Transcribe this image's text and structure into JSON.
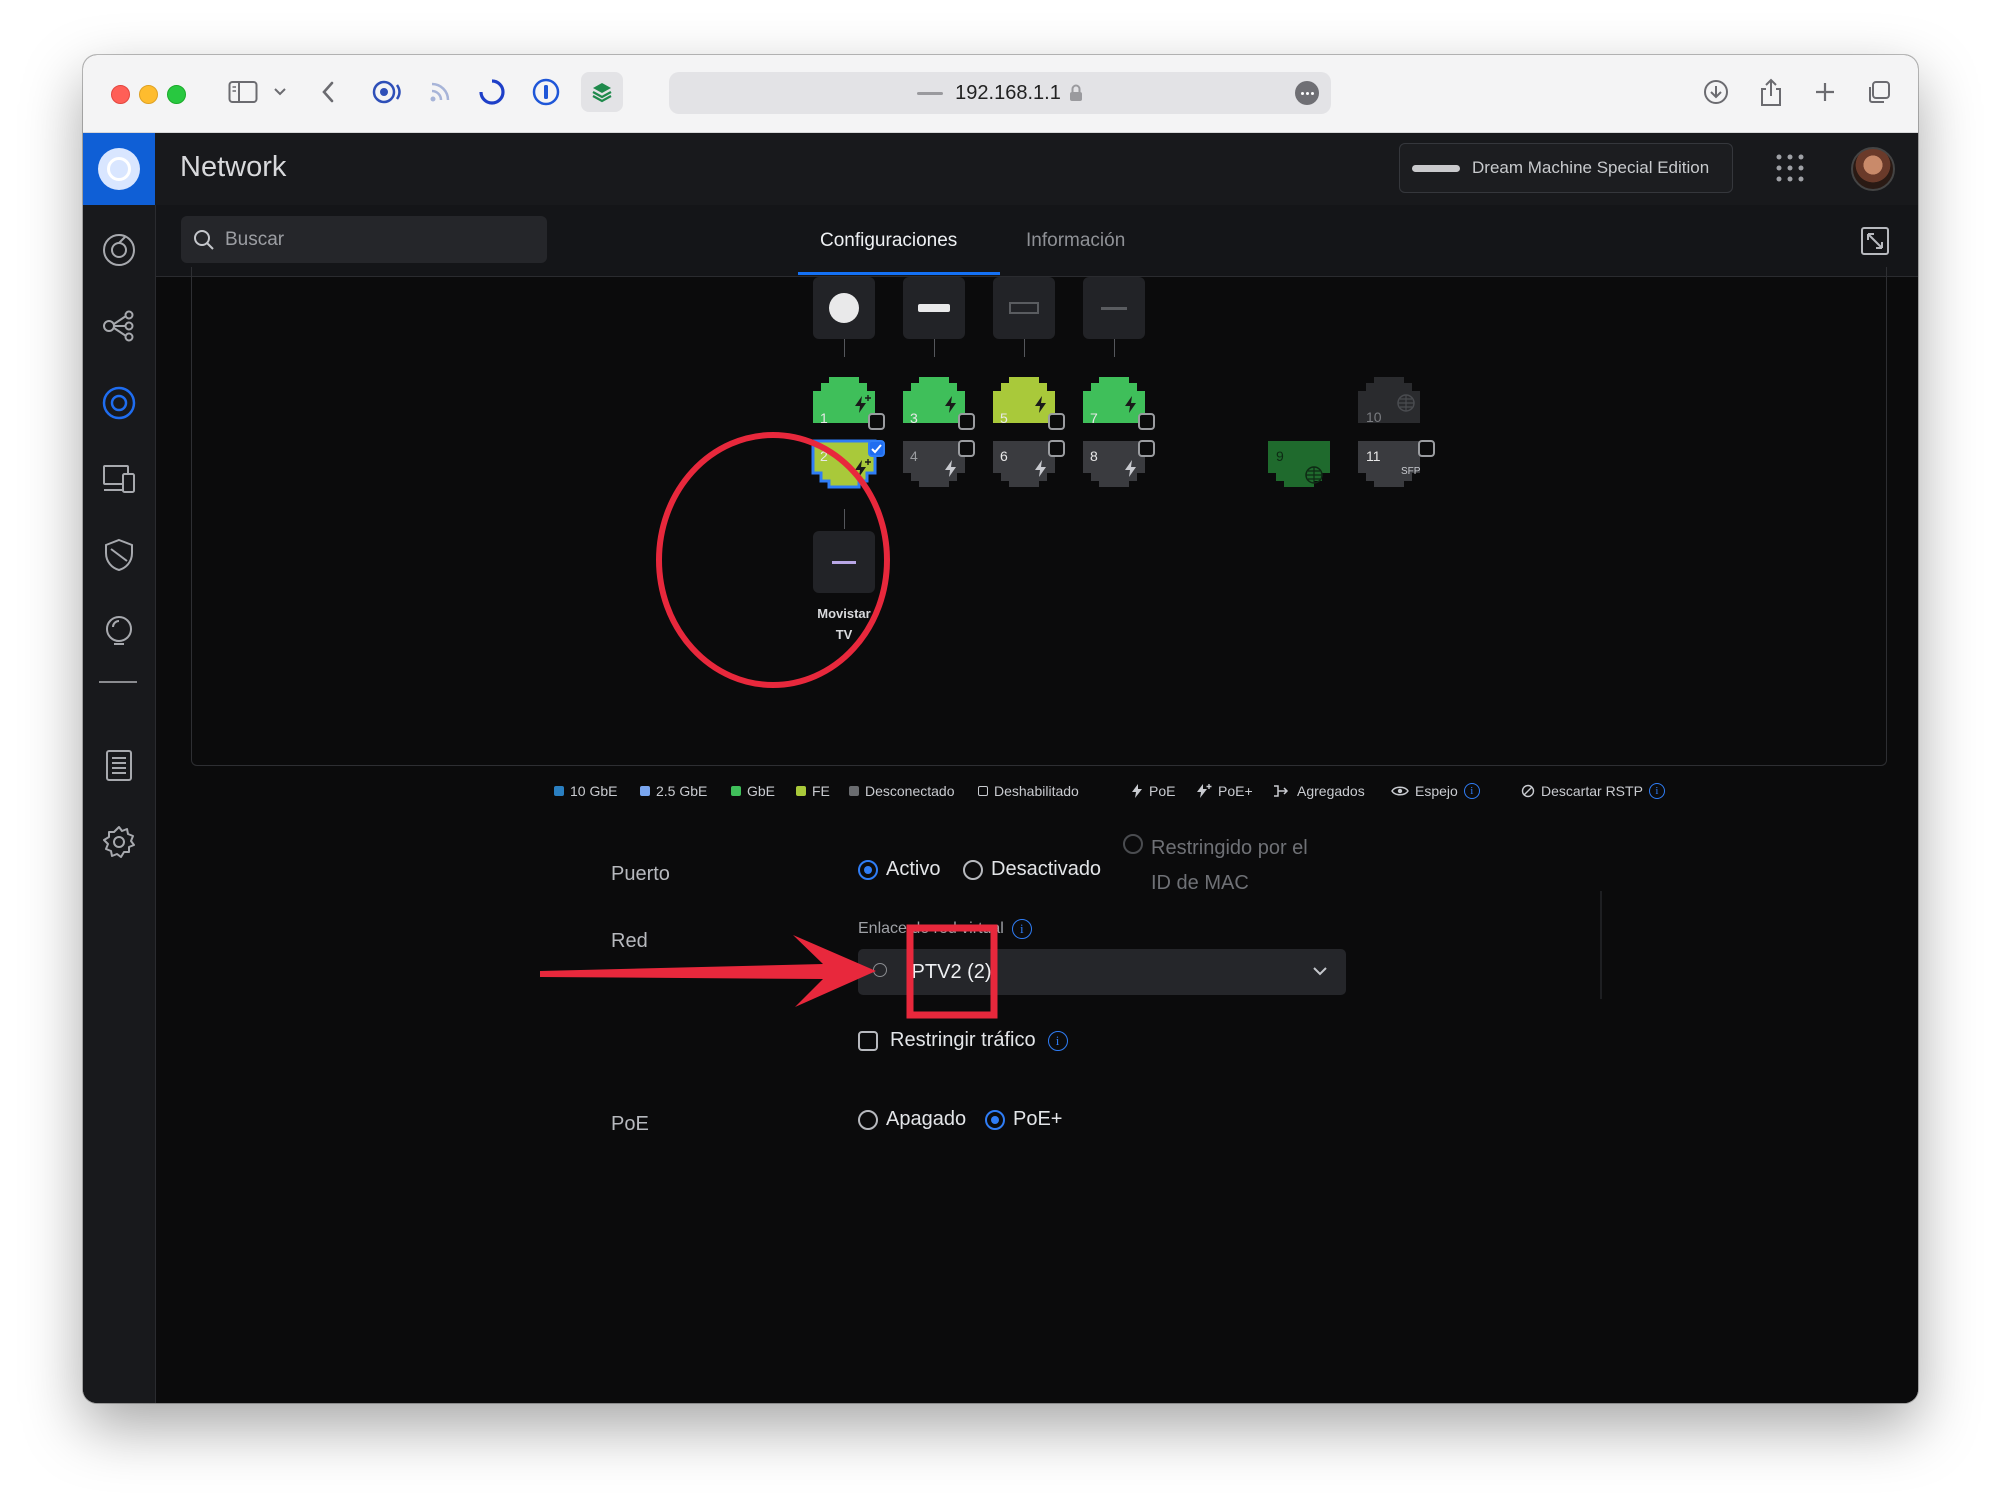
{
  "browser": {
    "url": "192.168.1.1"
  },
  "app": {
    "title": "Network",
    "device_name": "Dream Machine Special Edition"
  },
  "sidebar": {
    "items": [
      {
        "icon": "dashboard-icon"
      },
      {
        "icon": "topology-icon"
      },
      {
        "icon": "unifi-devices-icon"
      },
      {
        "icon": "client-devices-icon"
      },
      {
        "icon": "shield-icon"
      },
      {
        "icon": "insights-icon"
      },
      {
        "icon": "logs-icon"
      },
      {
        "icon": "gear-icon"
      }
    ]
  },
  "search": {
    "placeholder": "Buscar"
  },
  "tabs": [
    {
      "label": "Configuraciones",
      "active": true
    },
    {
      "label": "Información",
      "active": false
    }
  ],
  "ports": {
    "top_row": [
      {
        "num": "1",
        "color": "#3fbf5a"
      },
      {
        "num": "3",
        "color": "#3fbf5a"
      },
      {
        "num": "5",
        "color": "#a9c93a"
      },
      {
        "num": "7",
        "color": "#3fbf5a"
      }
    ],
    "bottom_row": [
      {
        "num": "2",
        "color": "#a9c93a"
      },
      {
        "num": "4",
        "color": "#3a3b3f"
      },
      {
        "num": "6",
        "color": "#3a3b3f"
      },
      {
        "num": "8",
        "color": "#3a3b3f"
      }
    ],
    "wan": [
      {
        "num": "10",
        "color": "#2a2b2e"
      },
      {
        "num": "9",
        "color": "#1f6a2d"
      },
      {
        "num": "11",
        "label": "SFP",
        "color": "#3a3b3f"
      }
    ]
  },
  "client_device": {
    "name_line1": "Movistar",
    "name_line2": "TV"
  },
  "legend": {
    "items": [
      {
        "label": "10 GbE",
        "color": "#2a7fc1"
      },
      {
        "label": "2.5 GbE",
        "color": "#7aa6ef"
      },
      {
        "label": "GbE",
        "color": "#3fbf5a"
      },
      {
        "label": "FE",
        "color": "#a9c93a"
      },
      {
        "label": "Desconectado",
        "color": "#6a6c70"
      },
      {
        "label": "Deshabilitado",
        "color": "transparent"
      }
    ],
    "poe": "PoE",
    "poe_plus": "PoE+",
    "agregados": "Agregados",
    "espejo": "Espejo",
    "rstp": "Descartar RSTP"
  },
  "form": {
    "puerto_label": "Puerto",
    "puerto_options": [
      "Activo",
      "Desactivado",
      "Restringido por el",
      "ID de MAC"
    ],
    "red_label": "Red",
    "vlan_field_label": "Enlace de red virtual",
    "vlan_value": "IPTV2 (2)",
    "restrict_label": "Restringir tráfico",
    "poe_label": "PoE",
    "poe_options": [
      "Apagado",
      "PoE+"
    ]
  },
  "annotations": {
    "circle_color": "#e8283c",
    "box_color": "#e8283c",
    "arrow_color": "#e8283c"
  }
}
